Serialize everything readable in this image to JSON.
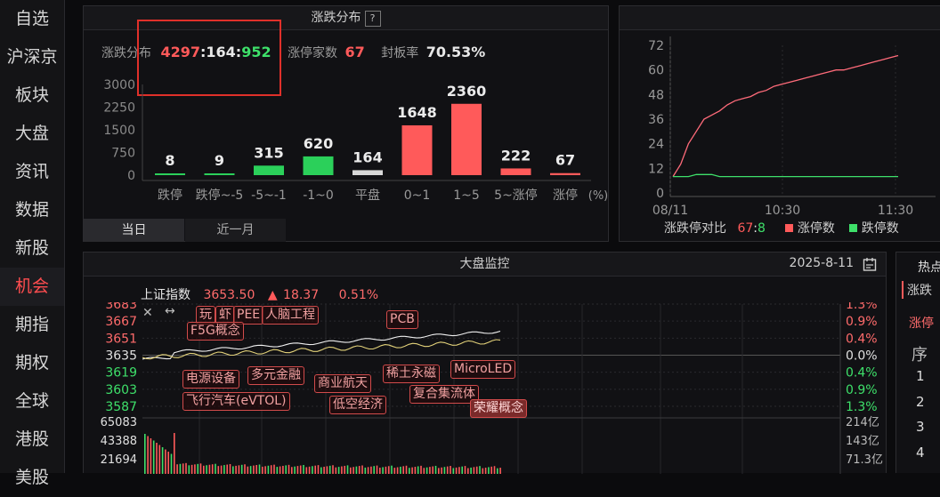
{
  "nav": {
    "items": [
      "自选",
      "沪深京",
      "板块",
      "大盘",
      "资讯",
      "数据",
      "新股",
      "机会",
      "期指",
      "期权",
      "全球",
      "港股",
      "美股"
    ],
    "active_index": 7
  },
  "dist": {
    "title": "涨跌分布",
    "help": "?",
    "summary_label": "涨跌分布",
    "up": "4297",
    "sep1": ":",
    "flat": "164",
    "sep2": ":",
    "down": "952",
    "limit_up_label": "涨停家数",
    "limit_up_value": "67",
    "seal_label": "封板率",
    "seal_value": "70.53%",
    "tabs": [
      "当日",
      "近一月"
    ],
    "pct_unit": "(%)"
  },
  "chart_data": [
    {
      "type": "bar",
      "categories": [
        "跌停",
        "跌停~-5",
        "-5~-1",
        "-1~0",
        "平盘",
        "0~1",
        "1~5",
        "5~涨停",
        "涨停"
      ],
      "values": [
        8,
        9,
        315,
        620,
        164,
        1648,
        2360,
        222,
        67
      ],
      "yticks": [
        "3000",
        "2250",
        "1500",
        "750",
        "0"
      ],
      "ylim": [
        0,
        3000
      ],
      "colors": [
        "#2bd05a",
        "#2bd05a",
        "#2bd05a",
        "#2bd05a",
        "#d8d8d8",
        "#ff5a5a",
        "#ff5a5a",
        "#ff5a5a",
        "#ff5a5a"
      ]
    },
    {
      "type": "line",
      "title": "涨跌停对比",
      "x_ticks": [
        "08/11",
        "10:30",
        "11:30"
      ],
      "yticks": [
        "72",
        "60",
        "48",
        "36",
        "24",
        "12",
        "0"
      ],
      "ylim": [
        0,
        72
      ],
      "series": [
        {
          "name": "涨停数",
          "color": "#ff6b7a",
          "values": [
            8,
            14,
            24,
            30,
            36,
            38,
            40,
            43,
            45,
            46,
            47,
            49,
            50,
            52,
            53,
            54,
            55,
            56,
            57,
            58,
            59,
            60,
            60,
            61,
            62,
            63,
            64,
            65,
            66,
            67
          ]
        },
        {
          "name": "跌停数",
          "color": "#3ee06a",
          "values": [
            8,
            8,
            8,
            9,
            9,
            9,
            8,
            8,
            8,
            8,
            8,
            8,
            8,
            8,
            8,
            8,
            8,
            8,
            8,
            8,
            8,
            8,
            8,
            8,
            8,
            8,
            8,
            8,
            8,
            8
          ]
        }
      ]
    }
  ],
  "compare": {
    "label": "涨跌停对比",
    "up": "67",
    "sep": ":",
    "down": "8",
    "legend_up": "涨停数",
    "legend_down": "跌停数"
  },
  "monitor": {
    "title": "大盘监控",
    "date": "2025-8-11",
    "index_name": "上证指数",
    "index_value": "3653.50",
    "index_change": "18.37",
    "index_pct": "0.51%",
    "price_ticks": [
      "3683",
      "3667",
      "3651",
      "3635",
      "3619",
      "3603",
      "3587"
    ],
    "pct_ticks": [
      "1.3%",
      "0.9%",
      "0.4%",
      "0.0%",
      "0.4%",
      "0.9%",
      "1.3%"
    ],
    "vol_ticks": [
      "65083",
      "43388",
      "21694"
    ],
    "amt_ticks": [
      "214亿",
      "143亿",
      "71.3亿"
    ],
    "tags": [
      "F5G概念",
      "飞行汽车(eVTOL)",
      "电源设备",
      "多元金融",
      "商业航天",
      "低空经济",
      "稀土永磁",
      "复合集流体",
      "MicroLED",
      "荣耀概念",
      "PCB",
      "人脑工程",
      "PEE",
      "玩",
      "虾"
    ]
  },
  "right_panel": {
    "title": "热点",
    "tab": "涨跌",
    "subtab": "涨停",
    "col_header": "序",
    "rows": [
      "1",
      "2",
      "3",
      "4"
    ]
  }
}
